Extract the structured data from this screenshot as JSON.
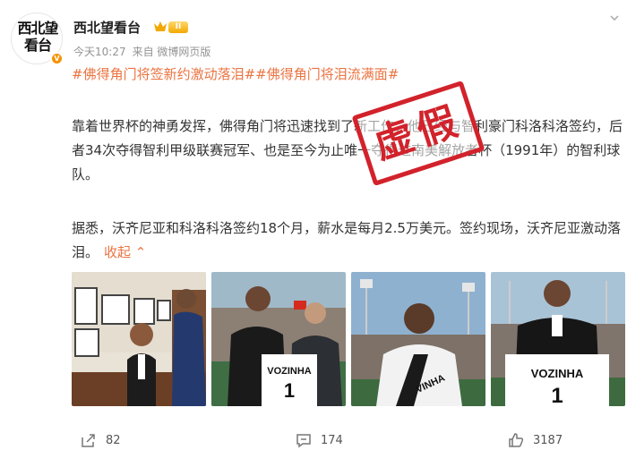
{
  "author": {
    "avatar_text": "西北望看台",
    "name": "西北望看台",
    "level": "II",
    "time": "今天10:27",
    "source": "来自 微博网页版"
  },
  "post": {
    "tags": "#佛得角门将签新约激动落泪##佛得角门将泪流满面#",
    "paragraph1": "靠着世界杯的神勇发挥，佛得角门将迅速找到了新工作，他已经与智利豪门科洛科洛签约，后者34次夺得智利甲级联赛冠军、也是至今为止唯一夺得过南美解放者杯（1991年）的智利球队。",
    "paragraph2": "据悉，沃齐尼亚和科洛科洛签约18个月，薪水是每月2.5万美元。签约现场，沃齐尼亚激动落泪。",
    "collapse_label": "收起",
    "stamp": "虚假"
  },
  "photos": [
    {
      "jersey": "",
      "number": ""
    },
    {
      "jersey": "VOZINHA",
      "number": "1"
    },
    {
      "jersey": "VINHA",
      "number": ""
    },
    {
      "jersey": "VOZINHA",
      "number": "1"
    }
  ],
  "actions": {
    "share_count": "82",
    "comment_count": "174",
    "like_count": "3187"
  },
  "colors": {
    "link": "#eb7340",
    "stamp": "#d2222b",
    "text": "#333333",
    "meta": "#939393"
  }
}
